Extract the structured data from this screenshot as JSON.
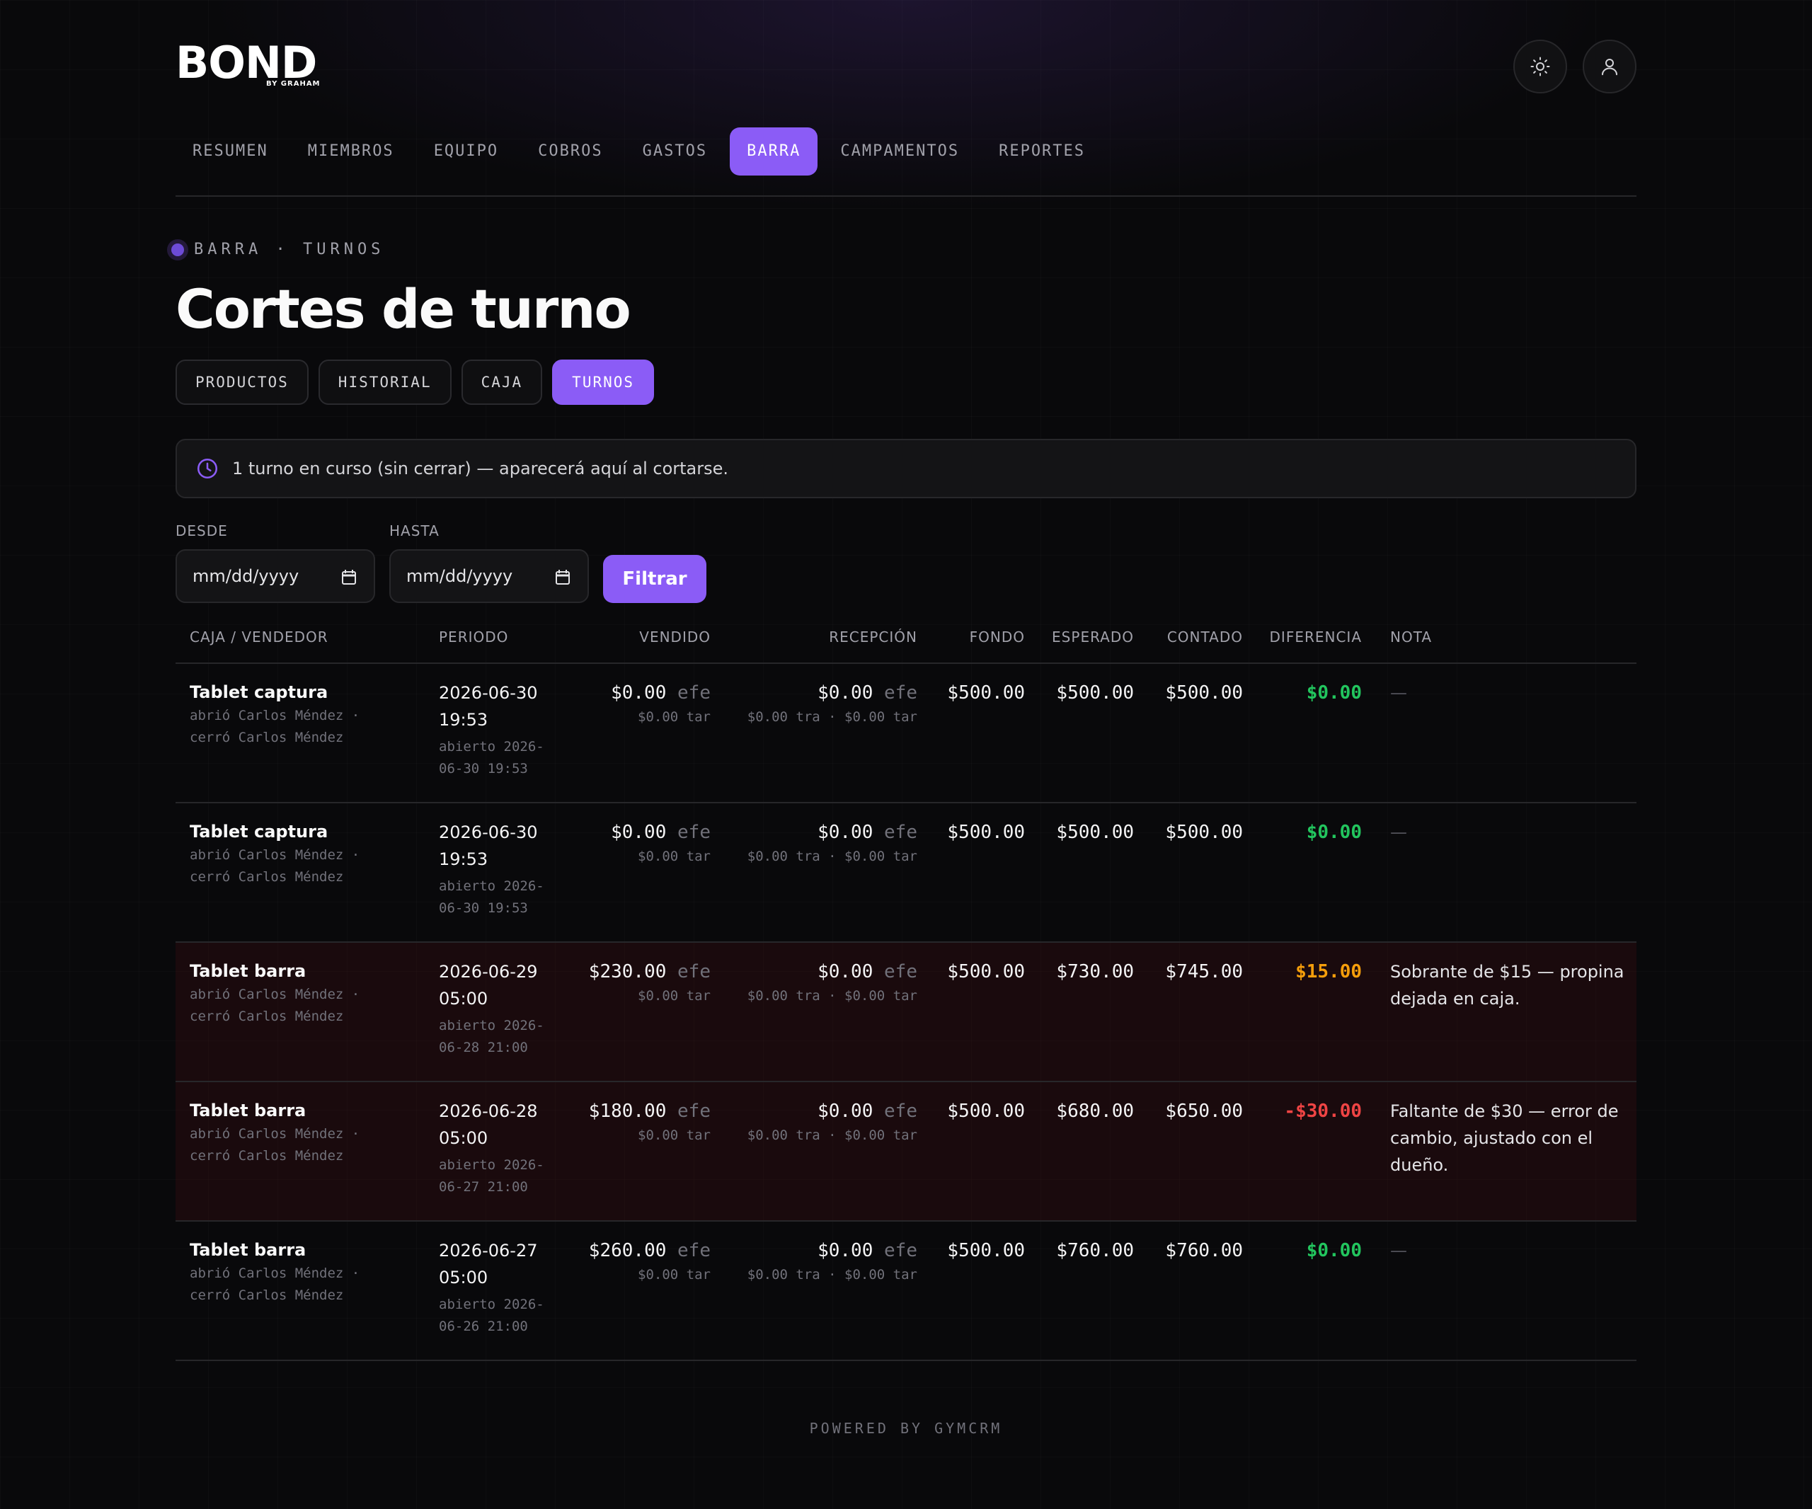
{
  "brand": {
    "name": "BOND",
    "sub": "BY GRAHAM"
  },
  "header": {
    "theme_icon": "sun-icon",
    "user_icon": "user-icon"
  },
  "nav": {
    "items": [
      {
        "label": "RESUMEN"
      },
      {
        "label": "MIEMBROS"
      },
      {
        "label": "EQUIPO"
      },
      {
        "label": "COBROS"
      },
      {
        "label": "GASTOS"
      },
      {
        "label": "BARRA",
        "active": true
      },
      {
        "label": "CAMPAMENTOS"
      },
      {
        "label": "REPORTES"
      }
    ]
  },
  "breadcrumb": "BARRA · TURNOS",
  "page_title": "Cortes de turno",
  "subtabs": [
    {
      "label": "PRODUCTOS"
    },
    {
      "label": "HISTORIAL"
    },
    {
      "label": "CAJA"
    },
    {
      "label": "TURNOS",
      "active": true
    }
  ],
  "notice": {
    "icon": "clock-icon",
    "text": "1 turno en curso (sin cerrar) — aparecerá aquí al cortarse."
  },
  "filters": {
    "desde_label": "DESDE",
    "hasta_label": "HASTA",
    "desde_value": "mm/dd/yyyy",
    "hasta_value": "mm/dd/yyyy",
    "button": "Filtrar"
  },
  "table": {
    "headers": {
      "caja": "CAJA / VENDEDOR",
      "periodo": "PERIODO",
      "vendido": "VENDIDO",
      "recepcion": "RECEPCIÓN",
      "fondo": "FONDO",
      "esperado": "ESPERADO",
      "contado": "CONTADO",
      "diferencia": "DIFERENCIA",
      "nota": "NOTA"
    },
    "rows": [
      {
        "caja": "Tablet captura",
        "abrio": "abrió Carlos Méndez ·",
        "cerro": "cerró Carlos Méndez",
        "periodo_1": "2026-06-30",
        "periodo_2": "19:53",
        "abierto_1": "abierto 2026-",
        "abierto_2": "06-30 19:53",
        "vendido": "$0.00",
        "vendido_unit": "efe",
        "vendido_tar": "$0.00 tar",
        "recepcion": "$0.00",
        "recepcion_unit": "efe",
        "recepcion_sub": "$0.00 tra · $0.00 tar",
        "fondo": "$500.00",
        "esperado": "$500.00",
        "contado": "$500.00",
        "diferencia": "$0.00",
        "diferencia_status": "green",
        "nota": "—"
      },
      {
        "caja": "Tablet captura",
        "abrio": "abrió Carlos Méndez ·",
        "cerro": "cerró Carlos Méndez",
        "periodo_1": "2026-06-30",
        "periodo_2": "19:53",
        "abierto_1": "abierto 2026-",
        "abierto_2": "06-30 19:53",
        "vendido": "$0.00",
        "vendido_unit": "efe",
        "vendido_tar": "$0.00 tar",
        "recepcion": "$0.00",
        "recepcion_unit": "efe",
        "recepcion_sub": "$0.00 tra · $0.00 tar",
        "fondo": "$500.00",
        "esperado": "$500.00",
        "contado": "$500.00",
        "diferencia": "$0.00",
        "diferencia_status": "green",
        "nota": "—"
      },
      {
        "caja": "Tablet barra",
        "abrio": "abrió Carlos Méndez ·",
        "cerro": "cerró Carlos Méndez",
        "periodo_1": "2026-06-29",
        "periodo_2": "05:00",
        "abierto_1": "abierto 2026-",
        "abierto_2": "06-28 21:00",
        "vendido": "$230.00",
        "vendido_unit": "efe",
        "vendido_tar": "$0.00 tar",
        "recepcion": "$0.00",
        "recepcion_unit": "efe",
        "recepcion_sub": "$0.00 tra · $0.00 tar",
        "fondo": "$500.00",
        "esperado": "$730.00",
        "contado": "$745.00",
        "diferencia": "$15.00",
        "diferencia_status": "orange",
        "nota": "Sobrante de $15 — propina dejada en caja."
      },
      {
        "caja": "Tablet barra",
        "abrio": "abrió Carlos Méndez ·",
        "cerro": "cerró Carlos Méndez",
        "periodo_1": "2026-06-28",
        "periodo_2": "05:00",
        "abierto_1": "abierto 2026-",
        "abierto_2": "06-27 21:00",
        "vendido": "$180.00",
        "vendido_unit": "efe",
        "vendido_tar": "$0.00 tar",
        "recepcion": "$0.00",
        "recepcion_unit": "efe",
        "recepcion_sub": "$0.00 tra · $0.00 tar",
        "fondo": "$500.00",
        "esperado": "$680.00",
        "contado": "$650.00",
        "diferencia": "-$30.00",
        "diferencia_status": "red",
        "nota": "Faltante de $30 — error de cambio, ajustado con el dueño."
      },
      {
        "caja": "Tablet barra",
        "abrio": "abrió Carlos Méndez ·",
        "cerro": "cerró Carlos Méndez",
        "periodo_1": "2026-06-27",
        "periodo_2": "05:00",
        "abierto_1": "abierto 2026-",
        "abierto_2": "06-26 21:00",
        "vendido": "$260.00",
        "vendido_unit": "efe",
        "vendido_tar": "$0.00 tar",
        "recepcion": "$0.00",
        "recepcion_unit": "efe",
        "recepcion_sub": "$0.00 tra · $0.00 tar",
        "fondo": "$500.00",
        "esperado": "$760.00",
        "contado": "$760.00",
        "diferencia": "$0.00",
        "diferencia_status": "green",
        "nota": "—"
      }
    ]
  },
  "footer": "POWERED BY GYMCRM",
  "colors": {
    "accent": "#8b5cf6",
    "positive": "#22c55e",
    "surplus": "#f59e0b",
    "deficit": "#ef4444"
  }
}
